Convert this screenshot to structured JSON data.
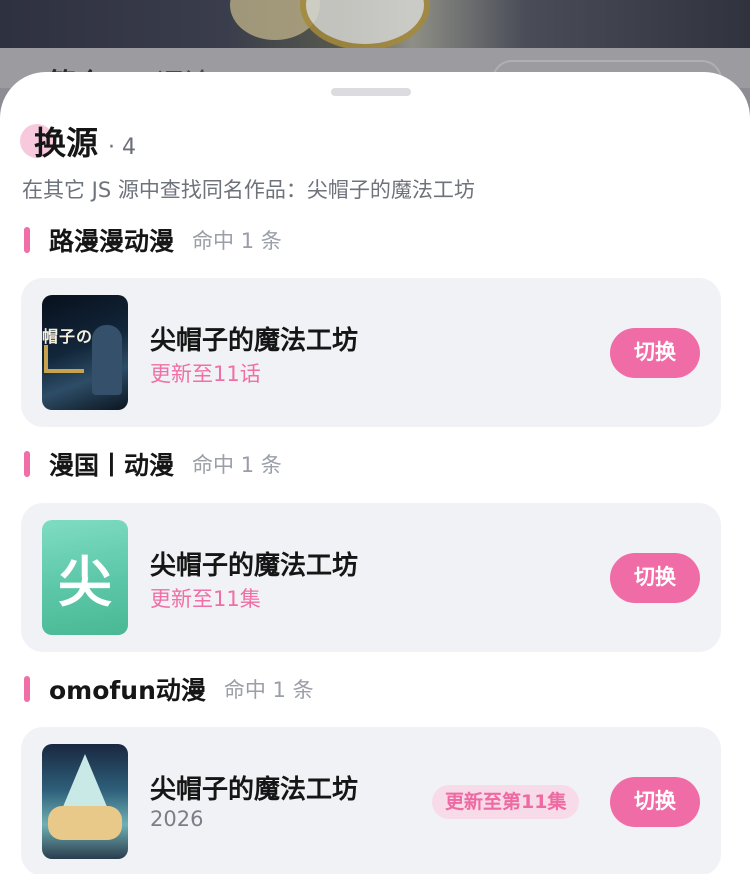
{
  "background": {
    "tabs": [
      "简介",
      "评论"
    ]
  },
  "sheet": {
    "title": "换源",
    "count": "· 4",
    "subtitle": "在其它 JS 源中查找同名作品：尖帽子的魔法工坊",
    "accent_color": "#ef6fa6"
  },
  "groups": [
    {
      "name": "路漫漫动漫",
      "hits": "命中 1 条",
      "item": {
        "title": "尖帽子的魔法工坊",
        "subtitle": "更新至11话",
        "thumb_text": "帽子の",
        "button": "切换"
      }
    },
    {
      "name": "漫国丨动漫",
      "hits": "命中 1 条",
      "item": {
        "title": "尖帽子的魔法工坊",
        "subtitle": "更新至11集",
        "thumb_letter": "尖",
        "button": "切换"
      }
    },
    {
      "name": "omofun动漫",
      "hits": "命中 1 条",
      "item": {
        "title": "尖帽子的魔法工坊",
        "subtitle": "2026",
        "badge": "更新至第11集",
        "button": "切换"
      }
    }
  ]
}
